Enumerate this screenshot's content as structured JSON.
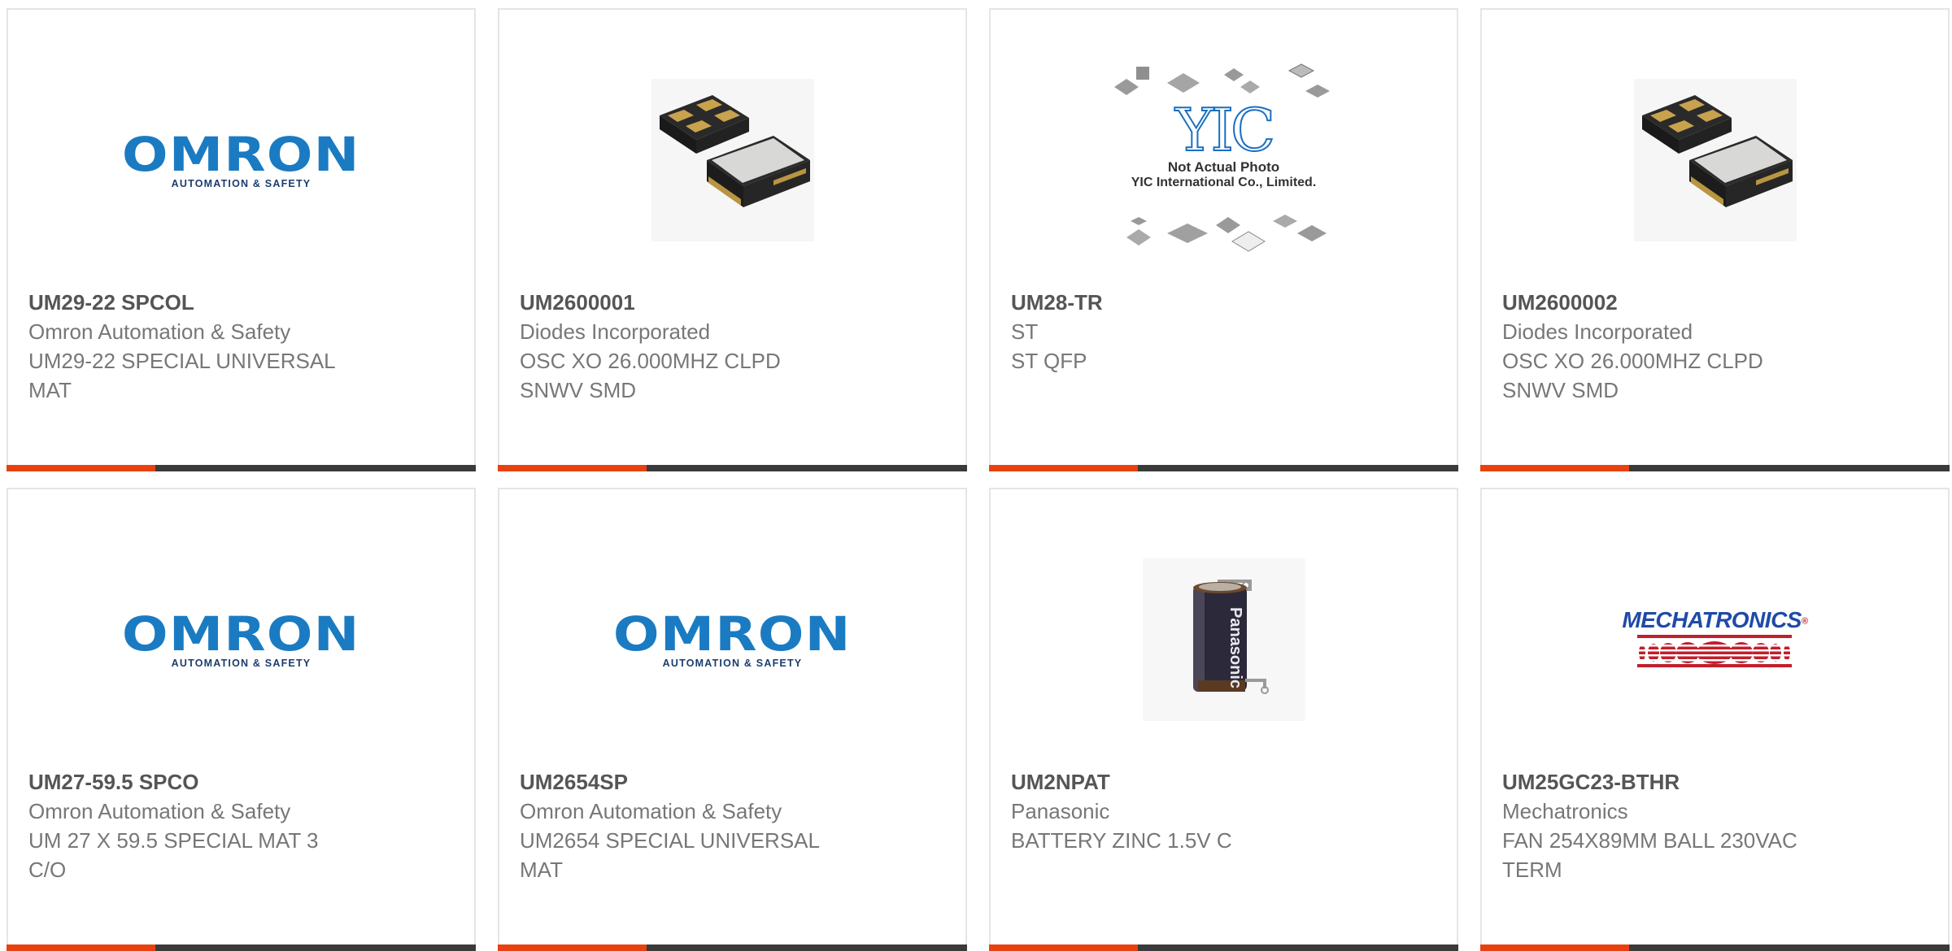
{
  "products": [
    {
      "part_number": "UM29-22 SPCOL",
      "manufacturer": "Omron Automation & Safety",
      "description_line1": "UM29-22 SPECIAL UNIVERSAL",
      "description_line2": "MAT",
      "image": "omron-logo",
      "logo": {
        "word": "OMRON",
        "sub": "AUTOMATION & SAFETY"
      }
    },
    {
      "part_number": "UM2600001",
      "manufacturer": "Diodes Incorporated",
      "description_line1": "OSC XO 26.000MHZ CLPD",
      "description_line2": "SNWV SMD",
      "image": "oscillator-photo"
    },
    {
      "part_number": "UM28-TR",
      "manufacturer": "ST",
      "description_line1": "ST QFP",
      "description_line2": "",
      "image": "yic-placeholder",
      "logo": {
        "word": "YIC",
        "line1": "Not Actual Photo",
        "line2": "YIC International Co., Limited."
      }
    },
    {
      "part_number": "UM2600002",
      "manufacturer": "Diodes Incorporated",
      "description_line1": "OSC XO 26.000MHZ CLPD",
      "description_line2": "SNWV SMD",
      "image": "oscillator-photo"
    },
    {
      "part_number": "UM27-59.5 SPCO",
      "manufacturer": "Omron Automation & Safety",
      "description_line1": "UM 27 X 59.5 SPECIAL MAT 3",
      "description_line2": "C/O",
      "image": "omron-logo",
      "logo": {
        "word": "OMRON",
        "sub": "AUTOMATION & SAFETY"
      }
    },
    {
      "part_number": "UM2654SP",
      "manufacturer": "Omron Automation & Safety",
      "description_line1": "UM2654 SPECIAL UNIVERSAL",
      "description_line2": "MAT",
      "image": "omron-logo",
      "logo": {
        "word": "OMRON",
        "sub": "AUTOMATION & SAFETY"
      }
    },
    {
      "part_number": "UM2NPAT",
      "manufacturer": "Panasonic",
      "description_line1": "BATTERY ZINC 1.5V C",
      "description_line2": "",
      "image": "battery-photo",
      "logo": {
        "word": "Panasonic"
      }
    },
    {
      "part_number": "UM25GC23-BTHR",
      "manufacturer": "Mechatronics",
      "description_line1": "FAN 254X89MM BALL 230VAC",
      "description_line2": "TERM",
      "image": "mechatronics-logo",
      "logo": {
        "word": "MECHATRONICS",
        "reg": "®"
      }
    }
  ],
  "colors": {
    "accent_bar": "#e8410f",
    "dark_bar": "#3a3a3a",
    "omron_blue": "#1a7bc2",
    "card_border": "#e5e5e5"
  }
}
